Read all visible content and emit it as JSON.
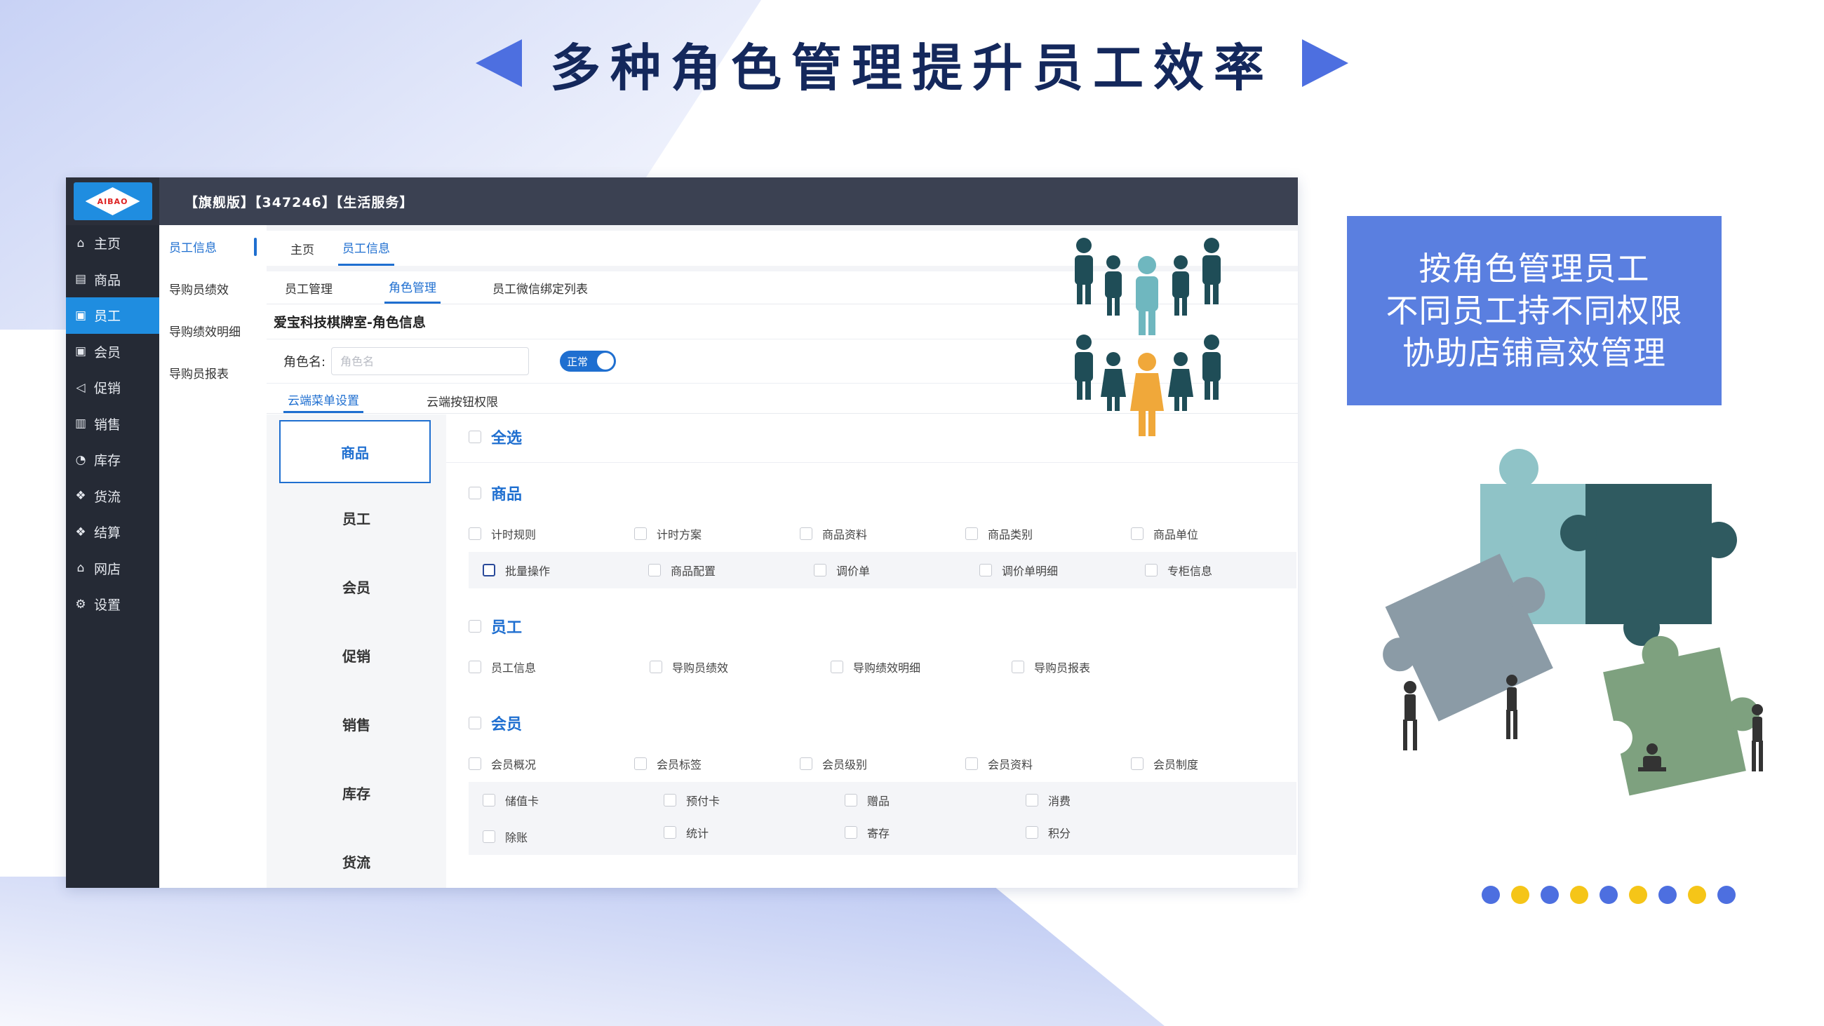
{
  "slide": {
    "title": "多种角色管理提升员工效率",
    "feature_lines": [
      "按角色管理员工",
      "不同员工持不同权限",
      "协助店铺高效管理"
    ],
    "colors": {
      "title": "#14285c",
      "accent": "#4d6fe0",
      "feature_box": "#5a7fe0",
      "dot_blue": "#4d6fe0",
      "dot_yellow": "#f5c518"
    },
    "dots": [
      "blue",
      "yellow",
      "blue",
      "yellow",
      "blue",
      "yellow",
      "blue",
      "yellow",
      "blue"
    ]
  },
  "app": {
    "logo_text": "AIBAO",
    "topbar_title": "【旗舰版】【347246】【生活服务】",
    "sidebar": [
      {
        "icon": "home-icon",
        "label": "主页",
        "active": false
      },
      {
        "icon": "goods-icon",
        "label": "商品",
        "active": false
      },
      {
        "icon": "staff-icon",
        "label": "员工",
        "active": true
      },
      {
        "icon": "member-icon",
        "label": "会员",
        "active": false
      },
      {
        "icon": "promo-icon",
        "label": "促销",
        "active": false
      },
      {
        "icon": "sales-icon",
        "label": "销售",
        "active": false
      },
      {
        "icon": "stock-icon",
        "label": "库存",
        "active": false
      },
      {
        "icon": "logistics-icon",
        "label": "货流",
        "active": false
      },
      {
        "icon": "settle-icon",
        "label": "结算",
        "active": false
      },
      {
        "icon": "shop-icon",
        "label": "网店",
        "active": false
      },
      {
        "icon": "settings-icon",
        "label": "设置",
        "active": false
      }
    ],
    "subnav": [
      "员工信息",
      "导购员绩效",
      "导购绩效明细",
      "导购员报表"
    ],
    "tabs_top": [
      "主页",
      "员工信息"
    ],
    "tabs_second": [
      "员工管理",
      "角色管理",
      "员工微信绑定列表"
    ],
    "shop_title": "爱宝科技棋牌室-角色信息",
    "role_label": "角色名:",
    "role_placeholder": "角色名",
    "toggle_label": "正常",
    "tabs_third": [
      "云端菜单设置",
      "云端按钮权限"
    ],
    "modules": [
      "商品",
      "员工",
      "会员",
      "促销",
      "销售",
      "库存",
      "货流"
    ],
    "select_all": "全选",
    "groups": [
      {
        "title": "商品",
        "rows": [
          [
            "计时规则",
            "计时方案",
            "商品资料",
            "商品类别",
            "商品单位"
          ],
          [
            "批量操作",
            "商品配置",
            "调价单",
            "调价单明细",
            "专柜信息"
          ]
        ]
      },
      {
        "title": "员工",
        "rows": [
          [
            "员工信息",
            "导购员绩效",
            "导购绩效明细",
            "导购员报表"
          ]
        ]
      },
      {
        "title": "会员",
        "rows": [
          [
            "会员概况",
            "会员标签",
            "会员级别",
            "会员资料",
            "会员制度"
          ],
          [
            "储值卡",
            "预付卡",
            "赠品",
            "消费",
            "除账"
          ],
          [
            "统计",
            "寄存",
            "积分"
          ]
        ]
      }
    ]
  }
}
